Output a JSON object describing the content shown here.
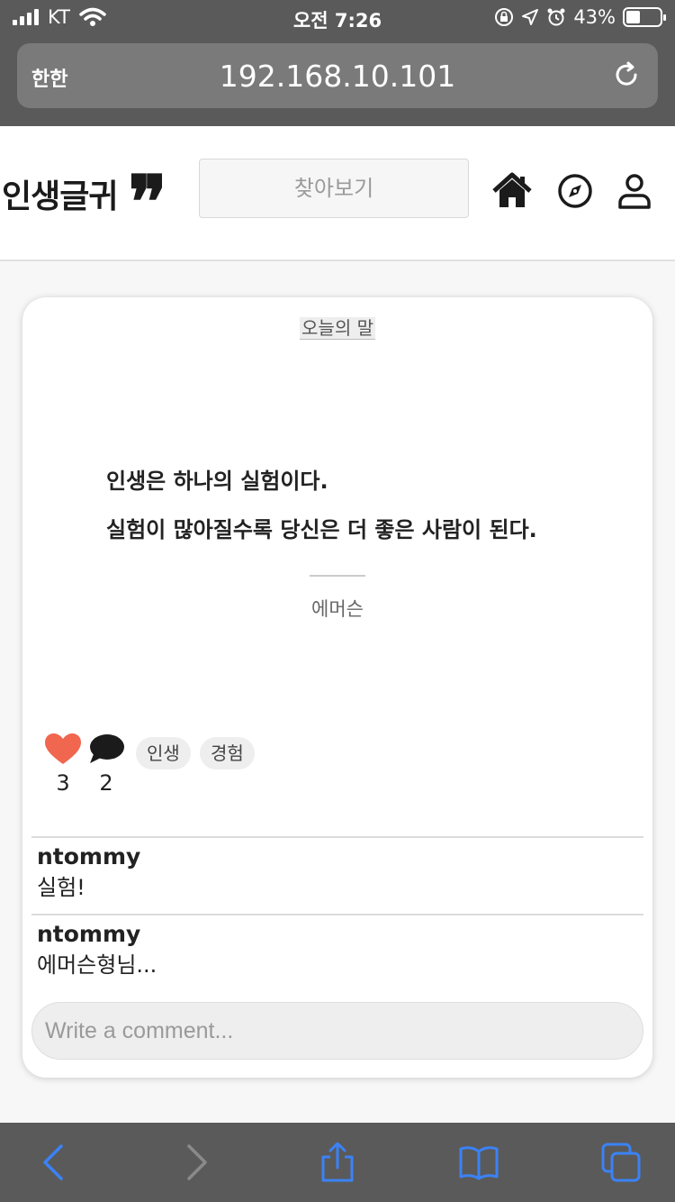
{
  "status_bar": {
    "carrier": "KT",
    "time": "오전 7:26",
    "battery": "43%",
    "battery_level": 0.43
  },
  "browser": {
    "text_size_button": "한한",
    "url": "192.168.10.101"
  },
  "site": {
    "logo_text": "인생글귀",
    "logo_quote_mark": "❞",
    "search_placeholder": "찾아보기",
    "nav": [
      "home-icon",
      "compass-icon",
      "user-icon"
    ]
  },
  "card": {
    "label": "오늘의 말",
    "quote_line1": "인생은 하나의 실험이다.",
    "quote_line2": "실험이 많아질수록 당신은 더 좋은 사람이 된다.",
    "author": "에머슨",
    "likes": "3",
    "comments_count": "2",
    "tags": [
      "인생",
      "경험"
    ],
    "comments": [
      {
        "user": "ntommy",
        "text": "실험!"
      },
      {
        "user": "ntommy",
        "text": "에머슨형님..."
      }
    ],
    "comment_placeholder": "Write a comment..."
  },
  "colors": {
    "heart": "#f0664f",
    "ios_blue": "#3b82f6",
    "chrome_gray": "#5a5a5a"
  }
}
